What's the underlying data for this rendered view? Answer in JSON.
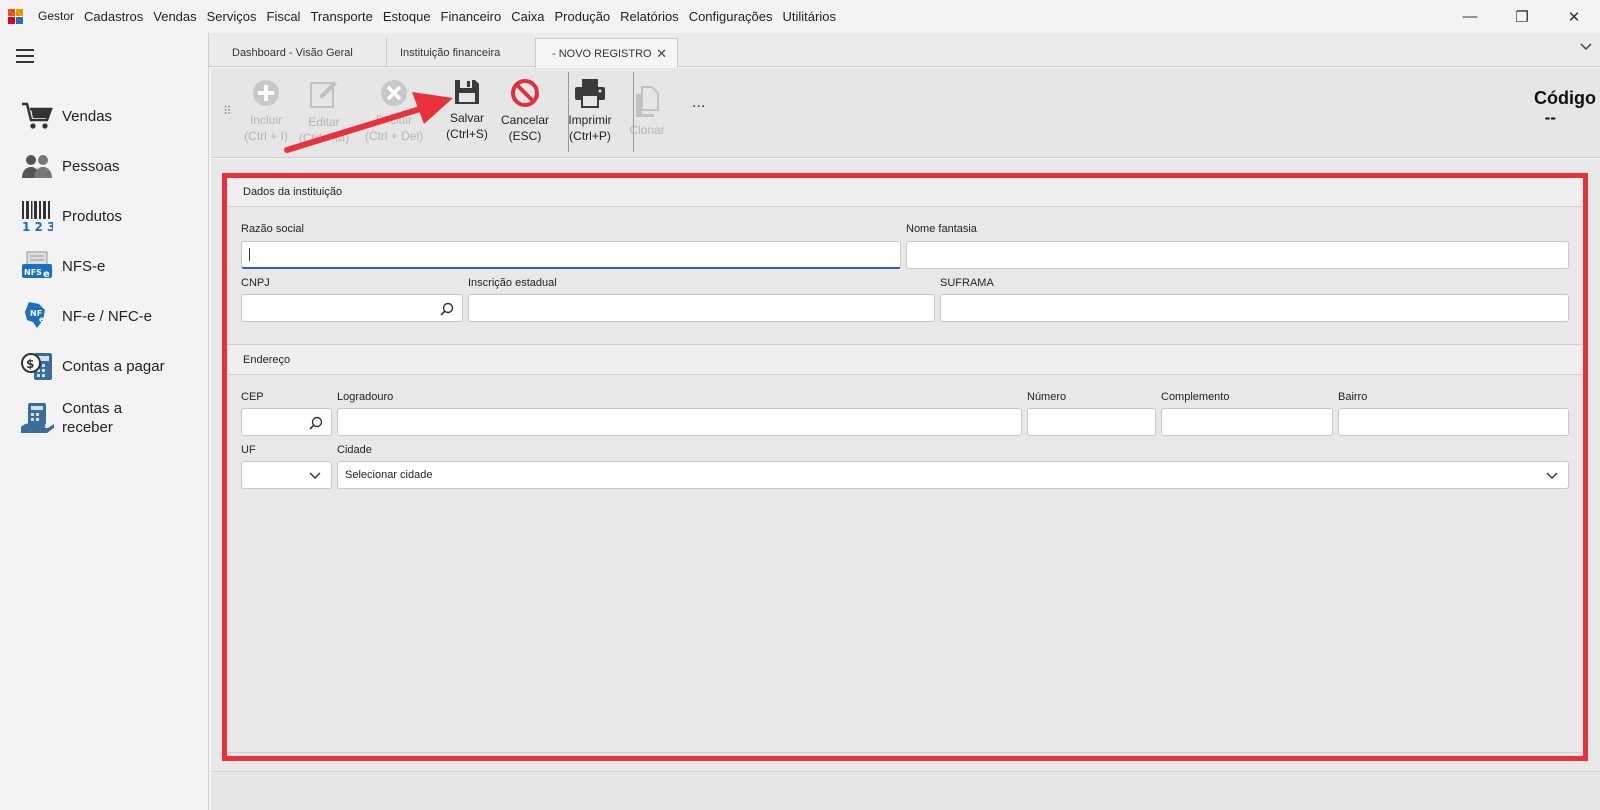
{
  "menubar": {
    "items": [
      "Gestor",
      "Cadastros",
      "Vendas",
      "Serviços",
      "Fiscal",
      "Transporte",
      "Estoque",
      "Financeiro",
      "Caixa",
      "Produção",
      "Relatórios",
      "Configurações",
      "Utilitários"
    ],
    "window_controls": {
      "minimize": "—",
      "restore": "❐",
      "close": "✕"
    }
  },
  "sidebar": {
    "items": [
      {
        "label": "Vendas",
        "icon": "shopping-cart-icon"
      },
      {
        "label": "Pessoas",
        "icon": "people-icon"
      },
      {
        "label": "Produtos",
        "icon": "barcode-icon"
      },
      {
        "label": "NFS-e",
        "icon": "nfse-icon"
      },
      {
        "label": "NF-e / NFC-e",
        "icon": "nfe-icon"
      },
      {
        "label": "Contas a pagar",
        "icon": "contas-pagar-icon"
      },
      {
        "label": "Contas a\nreceber",
        "icon": "contas-receber-icon"
      }
    ]
  },
  "tabs": [
    {
      "label": "Dashboard - Visão Geral",
      "active": false
    },
    {
      "label": "Instituição financeira",
      "active": false
    },
    {
      "label": "- NOVO REGISTRO",
      "active": true,
      "close": "✕"
    }
  ],
  "toolbar": {
    "buttons": [
      {
        "line1": "Incluir",
        "line2": "(Ctrl + I)",
        "enabled": false
      },
      {
        "line1": "Editar",
        "line2": "(Ctrl + M)",
        "enabled": false
      },
      {
        "line1": "Excluir",
        "line2": "(Ctrl + Del)",
        "enabled": false
      },
      {
        "line1": "Salvar",
        "line2": "(Ctrl+S)",
        "enabled": true
      },
      {
        "line1": "Cancelar",
        "line2": "(ESC)",
        "enabled": true
      },
      {
        "line1": "Imprimir",
        "line2": "(Ctrl+P)",
        "enabled": true
      },
      {
        "line1": "Clonar",
        "line2": "",
        "enabled": false
      }
    ],
    "more": "...",
    "codigo_label": "Código",
    "codigo_value": "--"
  },
  "form": {
    "section1": {
      "title": "Dados da instituição",
      "razao_social": {
        "label": "Razão social",
        "value": ""
      },
      "nome_fantasia": {
        "label": "Nome fantasia",
        "value": ""
      },
      "cnpj": {
        "label": "CNPJ",
        "value": ""
      },
      "inscricao_estadual": {
        "label": "Inscrição estadual",
        "value": ""
      },
      "suframa": {
        "label": "SUFRAMA",
        "value": ""
      }
    },
    "section2": {
      "title": "Endereço",
      "cep": {
        "label": "CEP",
        "value": ""
      },
      "logradouro": {
        "label": "Logradouro",
        "value": ""
      },
      "numero": {
        "label": "Número",
        "value": ""
      },
      "complemento": {
        "label": "Complemento",
        "value": ""
      },
      "bairro": {
        "label": "Bairro",
        "value": ""
      },
      "uf": {
        "label": "UF",
        "value": ""
      },
      "cidade": {
        "label": "Cidade",
        "value": "Selecionar cidade"
      }
    }
  },
  "colors": {
    "highlight": "#e8313a",
    "cancel": "#e0303a",
    "focus": "#2b5fa5",
    "icon_blue": "#1a6fc1"
  }
}
